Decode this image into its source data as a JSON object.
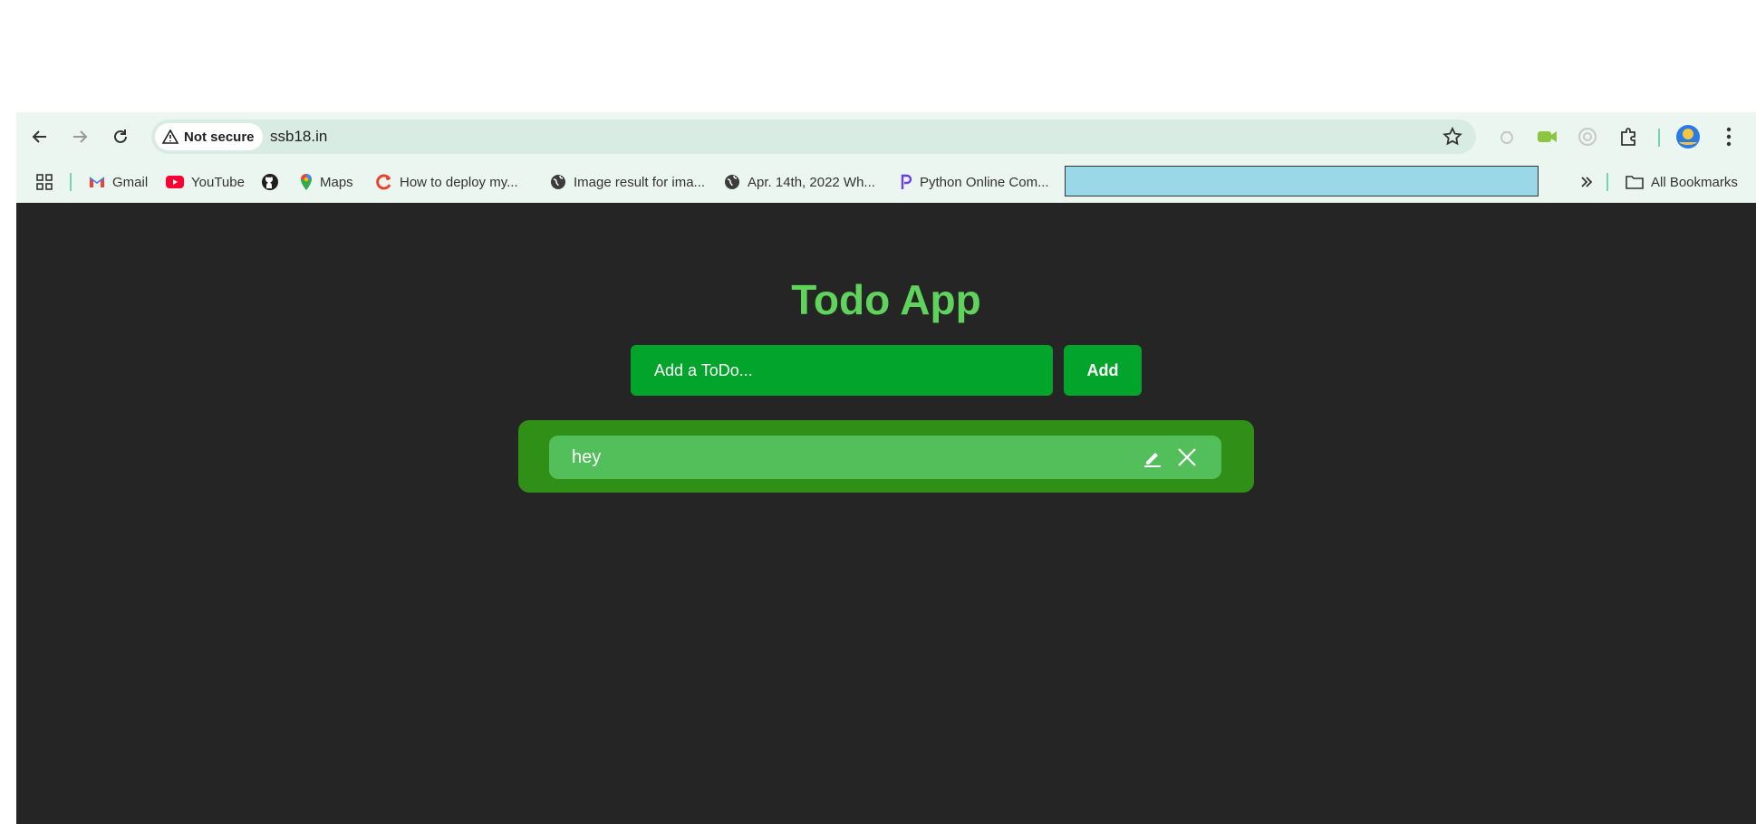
{
  "browser": {
    "security_label": "Not secure",
    "url": "ssb18.in",
    "icons": [
      "back-arrow-icon",
      "forward-arrow-icon",
      "reload-icon",
      "warning-triangle-icon",
      "star-icon",
      "extension-icon",
      "profile-avatar-icon",
      "kebab-menu-icon"
    ]
  },
  "bookmarks": {
    "items": [
      {
        "label": "Gmail",
        "icon": "gmail-icon"
      },
      {
        "label": "YouTube",
        "icon": "youtube-icon"
      },
      {
        "label": "",
        "icon": "github-icon"
      },
      {
        "label": "Maps",
        "icon": "maps-icon"
      },
      {
        "label": "How to deploy my...",
        "icon": "site-icon"
      },
      {
        "label": "Image result for ima...",
        "icon": "globe-icon"
      },
      {
        "label": "Apr. 14th, 2022 Wh...",
        "icon": "globe-icon"
      },
      {
        "label": "Python Online Com...",
        "icon": "site-icon"
      }
    ],
    "all_bookmarks_label": "All Bookmarks"
  },
  "app": {
    "title": "Todo App",
    "input_placeholder": "Add a ToDo...",
    "add_button_label": "Add",
    "todos": [
      {
        "text": "hey"
      }
    ]
  },
  "colors": {
    "page_bg": "#252525",
    "title": "#5fd35c",
    "input_bg": "#03a42b",
    "list_bg": "#2f8f16",
    "item_bg": "#52bf5a"
  }
}
